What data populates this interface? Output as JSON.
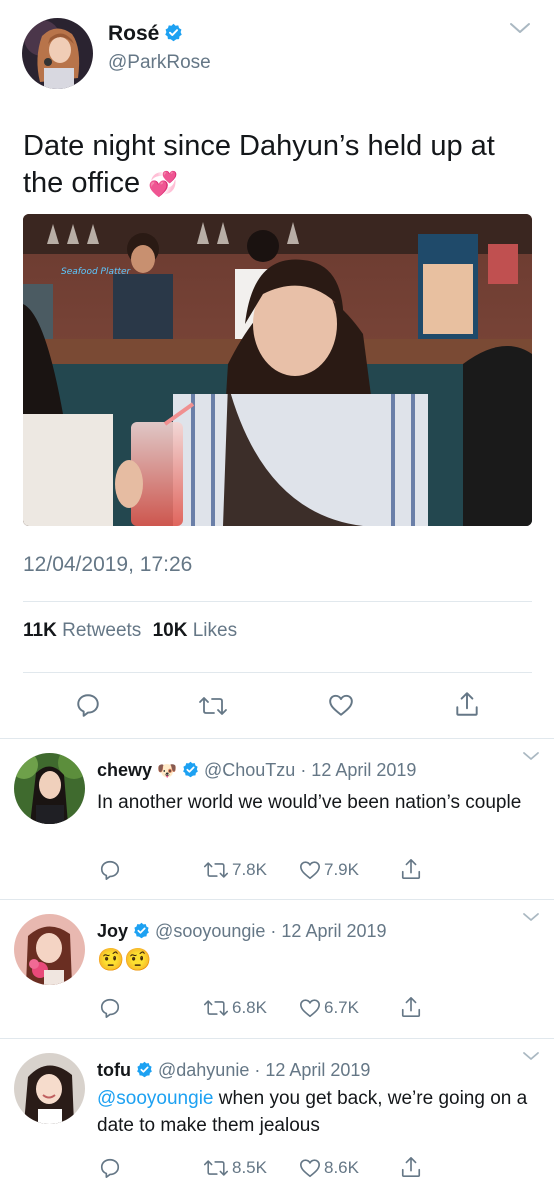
{
  "main_tweet": {
    "author_name": "Rosé",
    "author_handle": "@ParkRose",
    "text": "Date night since Dahyun’s held up at the office",
    "emoji": "💞",
    "timestamp": "12/04/2019, 17:26",
    "retweets_count": "11K",
    "retweets_label": "Retweets",
    "likes_count": "10K",
    "likes_label": "Likes",
    "photo_sign_text": "Seafood Platter"
  },
  "replies": [
    {
      "name": "chewy",
      "name_emoji": "🐶",
      "handle": "@ChouTzu",
      "date": "· 12 April 2019",
      "mention": "",
      "text": "In another world we would’ve been nation’s couple",
      "retweets": "7.8K",
      "likes": "7.9K"
    },
    {
      "name": "Joy",
      "name_emoji": "",
      "handle": "@sooyoungie",
      "date": "· 12 April 2019",
      "mention": "",
      "text": "🤨🤨",
      "retweets": "6.8K",
      "likes": "6.7K"
    },
    {
      "name": "tofu",
      "name_emoji": "",
      "handle": "@dahyunie",
      "date": "· 12 April 2019",
      "mention": "@sooyoungie",
      "text": " when you get back, we’re going on a date to make them jealous",
      "retweets": "8.5K",
      "likes": "8.6K"
    }
  ],
  "colors": {
    "accent": "#1da1f2",
    "secondary_text": "#657786",
    "divider": "#e1e8ed"
  }
}
